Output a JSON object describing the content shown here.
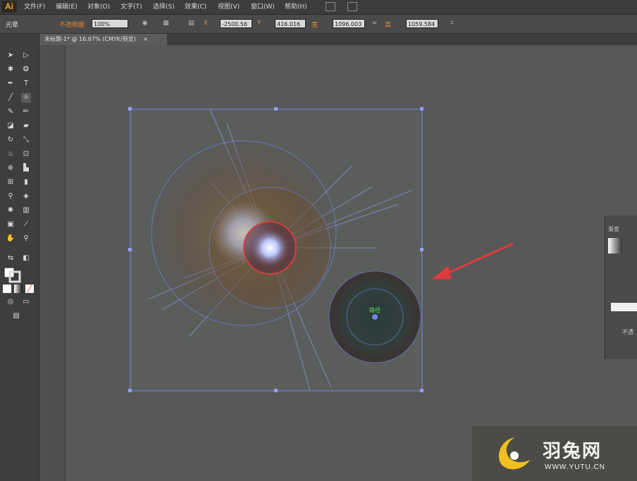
{
  "app": {
    "logo": "Ai"
  },
  "menu": [
    "文件(F)",
    "编辑(E)",
    "对象(O)",
    "文字(T)",
    "选择(S)",
    "效果(C)",
    "视图(V)",
    "窗口(W)",
    "帮助(H)"
  ],
  "control_bar": {
    "tool_name": "光晕",
    "opacity_warning": "不透明度",
    "opacity_value": "100%",
    "x_label": "X",
    "x_value": "-2500.56",
    "y_label": "Y",
    "y_value": "416.016",
    "w_label": "宽",
    "w_value": "1096.003",
    "h_label": "高",
    "h_value": "1059.584"
  },
  "document_tab": {
    "title": "未标题-1* @ 16.67% (CMYK/预览)",
    "close": "×"
  },
  "artboard": {
    "radius_label": "路径"
  },
  "panel": {
    "tab_label": "渐变",
    "bottom_text": "不透"
  },
  "watermark": {
    "brand_cn": "羽兔网",
    "url": "WWW.YUTU.CN"
  },
  "colors": {
    "accent_red": "#e03a3a",
    "selection_blue": "#6f86e6",
    "ai_orange": "#e9a23b"
  }
}
